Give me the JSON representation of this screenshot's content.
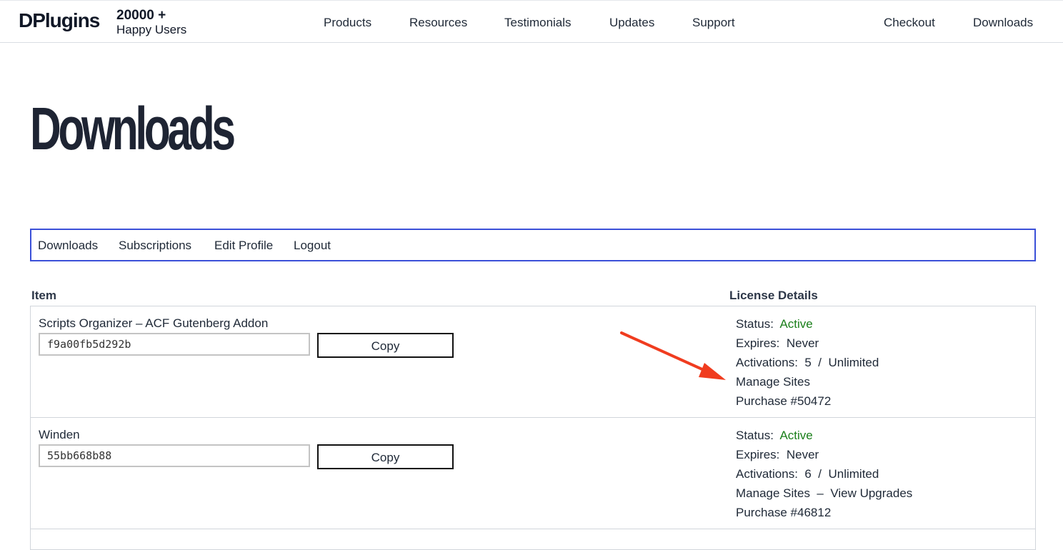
{
  "header": {
    "logo_text": "DPlugins",
    "users_count": "20000 +",
    "users_label": "Happy Users",
    "nav": [
      "Products",
      "Resources",
      "Testimonials",
      "Updates",
      "Support"
    ],
    "nav_right": [
      "Checkout",
      "Downloads"
    ]
  },
  "page": {
    "title": "Downloads"
  },
  "account_tabs": [
    "Downloads",
    "Subscriptions",
    "Edit Profile",
    "Logout"
  ],
  "table": {
    "col_item": "Item",
    "col_license": "License Details",
    "copy_label": "Copy",
    "status_label": "Status:",
    "expires_label": "Expires:",
    "activations_label": "Activations:",
    "manage_sites_label": "Manage Sites",
    "view_upgrades_label": "View Upgrades",
    "rows": [
      {
        "name": "Scripts Organizer – ACF Gutenberg Addon",
        "key": "f9a00fb5d292b",
        "status": "Active",
        "expires": "Never",
        "activations_used": "5",
        "activations_limit": "Unlimited",
        "purchase": "Purchase #50472"
      },
      {
        "name": "Winden",
        "key": "55bb668b88",
        "status": "Active",
        "expires": "Never",
        "activations_used": "6",
        "activations_limit": "Unlimited",
        "purchase": "Purchase #46812"
      }
    ]
  },
  "colors": {
    "accent_border": "#3b50d8",
    "status_active": "#1a7f1a",
    "annotation_arrow": "#f03c1f"
  }
}
